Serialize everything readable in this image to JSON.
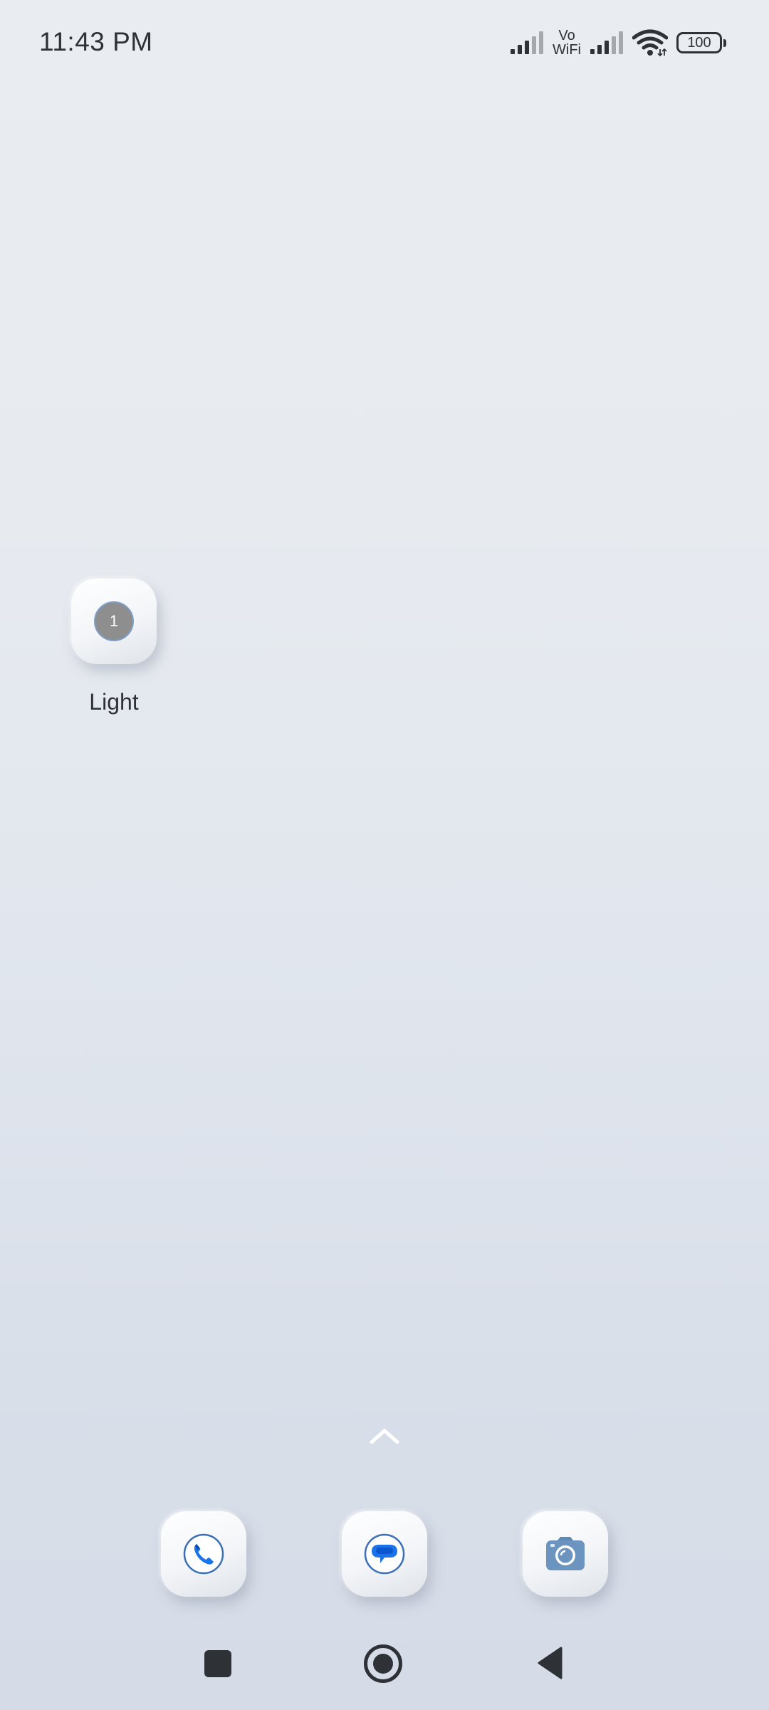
{
  "status_bar": {
    "time": "11:43 PM",
    "vowifi_top": "Vo",
    "vowifi_bottom": "WiFi",
    "battery_level": "100",
    "icons": [
      "signal-strength-icon",
      "vowifi-icon",
      "signal-strength-icon",
      "wifi-icon",
      "battery-icon"
    ]
  },
  "home_screen": {
    "apps": [
      {
        "label": "Light",
        "badge": "1",
        "icon": "light-app-icon"
      }
    ],
    "drawer_hint_icon": "chevron-up-icon"
  },
  "dock": {
    "apps": [
      {
        "icon": "phone-icon"
      },
      {
        "icon": "messages-icon"
      },
      {
        "icon": "camera-icon"
      }
    ]
  },
  "nav_bar": {
    "buttons": [
      "recents-icon",
      "home-icon",
      "back-icon"
    ]
  },
  "colors": {
    "accent_blue": "#1a73e8",
    "icon_dark": "#2e3136",
    "camera_blue": "#5b88b4"
  }
}
